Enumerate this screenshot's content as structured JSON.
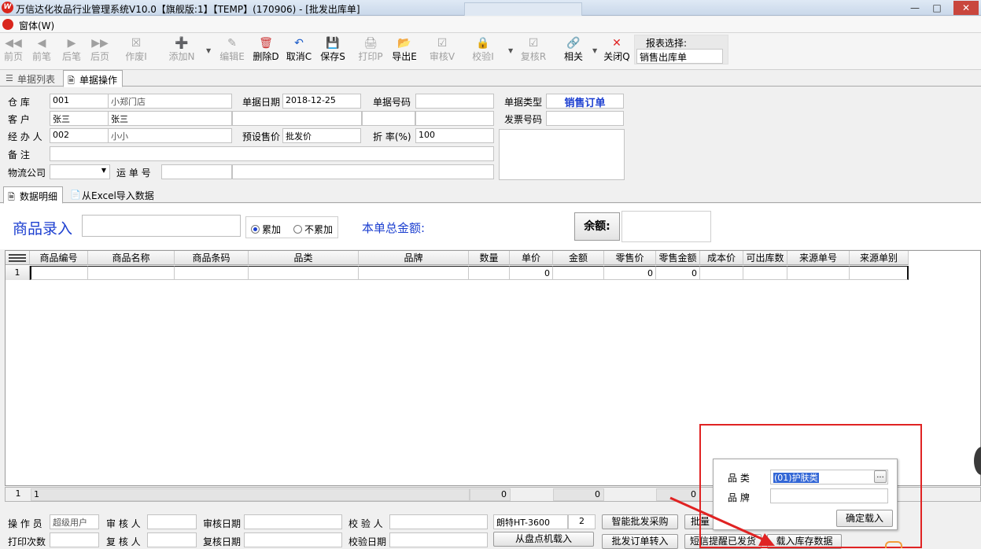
{
  "window": {
    "title": "万信达化妆品行业管理系统V10.0【旗舰版:1】【TEMP】(170906) - [批发出库单]"
  },
  "menubar": {
    "window_menu": "窗体(W)"
  },
  "toolbar": {
    "buttons": [
      {
        "label": "前页",
        "icon": "first-icon",
        "enabled": false
      },
      {
        "label": "前笔",
        "icon": "prev-icon",
        "enabled": false
      },
      {
        "label": "后笔",
        "icon": "next-icon",
        "enabled": false
      },
      {
        "label": "后页",
        "icon": "last-icon",
        "enabled": false
      },
      {
        "label": "作废I",
        "icon": "void-icon",
        "enabled": false
      },
      {
        "label": "添加N",
        "icon": "add-icon",
        "enabled": false
      },
      {
        "label": "编辑E",
        "icon": "edit-icon",
        "enabled": false
      },
      {
        "label": "删除D",
        "icon": "delete-icon",
        "enabled": true
      },
      {
        "label": "取消C",
        "icon": "undo-icon",
        "enabled": true
      },
      {
        "label": "保存S",
        "icon": "save-icon",
        "enabled": true
      },
      {
        "label": "打印P",
        "icon": "print-icon",
        "enabled": false
      },
      {
        "label": "导出E",
        "icon": "export-icon",
        "enabled": true
      },
      {
        "label": "审核V",
        "icon": "approve-icon",
        "enabled": false
      },
      {
        "label": "校验I",
        "icon": "verify-icon",
        "enabled": false
      },
      {
        "label": "复核R",
        "icon": "recheck-icon",
        "enabled": false
      },
      {
        "label": "相关",
        "icon": "link-icon",
        "enabled": true
      },
      {
        "label": "关闭Q",
        "icon": "close-icon",
        "enabled": true
      }
    ],
    "report_select_label": "报表选择:",
    "report_select_value": "销售出库单"
  },
  "tabs_top": [
    {
      "label": "单据列表"
    },
    {
      "label": "单据操作"
    }
  ],
  "form": {
    "warehouse_label": "仓    库",
    "warehouse_code": "001",
    "warehouse_name": "小郑门店",
    "date_label": "单据日期",
    "date_value": "2018-12-25",
    "number_label": "单据号码",
    "number_value": "",
    "type_label": "单据类型",
    "type_value": "销售订单",
    "customer_label": "客    户",
    "customer_code": "张三",
    "customer_name": "张三",
    "invoice_label": "发票号码",
    "invoice_value": "",
    "handler_label": "经 办 人",
    "handler_code": "002",
    "handler_name": "小小",
    "price_label": "预设售价",
    "price_value": "批发价",
    "discount_label": "折  率(%)",
    "discount_value": "100",
    "remark_label": "备    注",
    "remark_value": "",
    "logistics_label": "物流公司",
    "logistics_value": "",
    "waybill_label": "运 单 号",
    "waybill_value": ""
  },
  "tabs_detail": [
    {
      "label": "数据明细"
    },
    {
      "label": "从Excel导入数据"
    }
  ],
  "entry": {
    "product_entry_label": "商品录入",
    "radio_accumulate": "累加",
    "radio_no_accumulate": "不累加",
    "total_label": "本单总金额:",
    "balance_label": "余额:"
  },
  "grid": {
    "columns": [
      "商品编号",
      "商品名称",
      "商品条码",
      "品类",
      "品牌",
      "数量",
      "单价",
      "金额",
      "零售价",
      "零售金额",
      "成本价",
      "可出库数",
      "来源单号",
      "来源单别"
    ],
    "rows": [
      {
        "index": "1",
        "cells": [
          "",
          "",
          "",
          "",
          "",
          "",
          "0",
          "",
          "0",
          "0",
          "",
          "",
          "",
          ""
        ]
      }
    ],
    "footer": {
      "row_count": "1",
      "row_count_cell": "1",
      "qty_total": "0",
      "amount_total": "0",
      "retail_total": "0"
    }
  },
  "bottom": {
    "operator_label": "操 作 员",
    "operator_value": "超级用户",
    "reviewer_label": "审 核 人",
    "reviewer_value": "",
    "review_date_label": "审核日期",
    "review_date_value": "",
    "verifier_label": "校 验 人",
    "verifier_value": "",
    "device_value": "朗特HT-3600",
    "device_qty": "2",
    "print_count_label": "打印次数",
    "print_count_value": "",
    "rechecker_label": "复 核 人",
    "rechecker_value": "",
    "recheck_date_label": "复核日期",
    "recheck_date_value": "",
    "verify_date_label": "校验日期",
    "verify_date_value": "",
    "btn_smart_purchase": "智能批发采购",
    "btn_batch": "批量",
    "btn_load_inventory_count": "从盘点机载入",
    "btn_order_transfer": "批发订单转入",
    "btn_sms": "短信提醒已发货",
    "btn_load_stock": "载入库存数据"
  },
  "popup": {
    "category_label": "品    类",
    "category_value": "(01)护肤类",
    "brand_label": "品    牌",
    "brand_value": "",
    "confirm_button": "确定载入",
    "browse_button": "..."
  },
  "colors": {
    "accent_blue": "#1c3fd0",
    "annotation_red": "#e02323"
  }
}
